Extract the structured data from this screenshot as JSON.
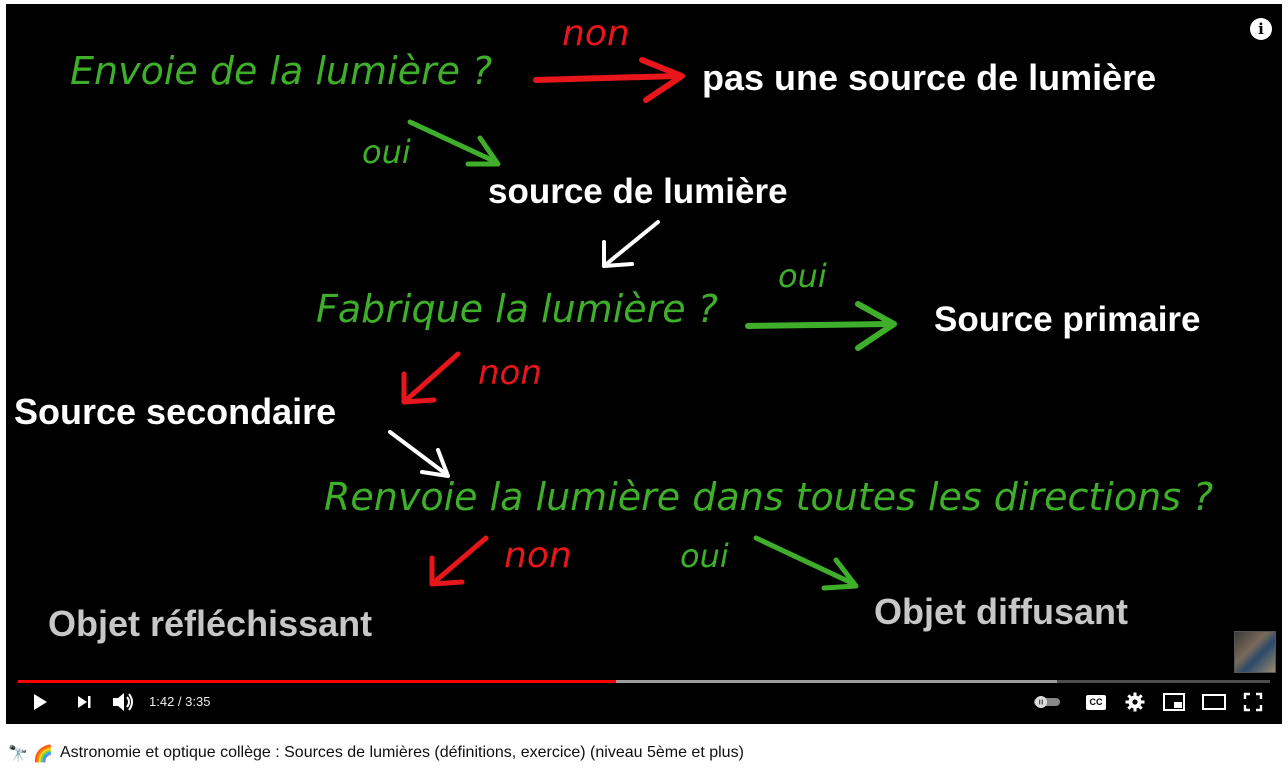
{
  "video": {
    "diagram": {
      "q1": "Envoie de la lumière ?",
      "no1": "non",
      "result_no_light": "pas une source de lumière",
      "yes1": "oui",
      "result_source": "source de lumière",
      "q2": "Fabrique la lumière ?",
      "yes2": "oui",
      "result_primary": "Source primaire",
      "no2": "non",
      "result_secondary": "Source secondaire",
      "q3": "Renvoie la lumière dans toutes les directions ?",
      "no3": "non",
      "yes3": "oui",
      "result_reflecting": "Objet réfléchissant",
      "result_diffusing": "Objet diffusant"
    },
    "colors": {
      "question_green": "#3fae2a",
      "answer_red": "#e8161b",
      "result_white": "#ffffff",
      "result_grey": "#c7c7c7",
      "progress_red": "#ff0000"
    }
  },
  "player": {
    "time_current": "1:42",
    "time_separator": " / ",
    "time_total": "3:35",
    "progress_played": 0.478,
    "progress_loaded": 0.83,
    "controls": {
      "play": "play-icon",
      "next": "next-icon",
      "volume": "volume-icon",
      "autoplay": "autoplay-toggle-icon",
      "captions": "captions-icon",
      "captions_text": "CC",
      "settings": "gear-icon",
      "miniplayer": "miniplayer-icon",
      "theater": "theater-icon",
      "fullscreen": "fullscreen-icon",
      "info": "info-icon",
      "info_text": "i"
    }
  },
  "page": {
    "title": "Astronomie et optique collège : Sources de lumières (définitions, exercice) (niveau 5ème et plus)",
    "emoji_1": "🔭",
    "emoji_2": "🌈"
  }
}
